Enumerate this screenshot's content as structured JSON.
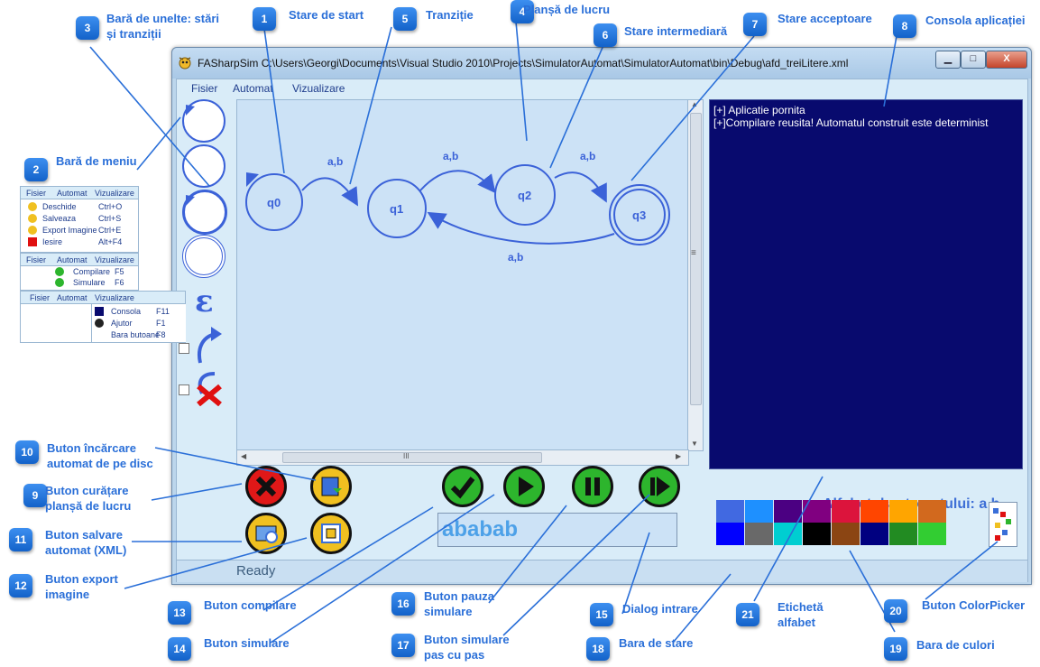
{
  "window": {
    "title": "FASharpSim C:\\Users\\Georgi\\Documents\\Visual Studio 2010\\Projects\\SimulatorAutomat\\SimulatorAutomat\\bin\\Debug\\afd_treiLitere.xml",
    "minimize": "▁",
    "maximize": "□",
    "close": "X"
  },
  "menu": {
    "file": "Fisier",
    "automaton": "Automat",
    "view": "Vizualizare"
  },
  "automaton": {
    "states": [
      "q0",
      "q1",
      "q2",
      "q3"
    ],
    "transitions": [
      "a,b",
      "a,b",
      "a,b",
      "a,b"
    ]
  },
  "console": {
    "lines": [
      "[+] Aplicatie pornita",
      "[+]Compilare reusita! Automatul construit este determinist"
    ]
  },
  "input": {
    "value": "ababab"
  },
  "alphabet_label": "Alfabetul automatului: a b",
  "status": "Ready",
  "scroll_glyphs": {
    "up": "▲",
    "down": "▼",
    "left": "◀",
    "right": "▶",
    "grip": "≡",
    "hgrip": "III"
  },
  "colors": {
    "top_row": [
      "#4169e1",
      "#1e90ff",
      "#4b0082",
      "#800080",
      "#dc143c",
      "#ff4500",
      "#ffa500",
      "#d2691e"
    ],
    "bottom_row": [
      "#0000ff",
      "#696969",
      "#00ced1",
      "#000000",
      "#8b4513",
      "#000080",
      "#228b22",
      "#32cd32"
    ]
  },
  "inset_menus": {
    "file": {
      "tabs": [
        "Fisier",
        "Automat",
        "Vizualizare"
      ],
      "items": [
        {
          "label": "Deschide",
          "shortcut": "Ctrl+O"
        },
        {
          "label": "Salveaza",
          "shortcut": "Ctrl+S"
        },
        {
          "label": "Export Imagine",
          "shortcut": "Ctrl+E"
        },
        {
          "label": "Iesire",
          "shortcut": "Alt+F4"
        }
      ]
    },
    "automaton": {
      "tabs": [
        "Fisier",
        "Automat",
        "Vizualizare"
      ],
      "items": [
        {
          "label": "Compilare",
          "shortcut": "F5"
        },
        {
          "label": "Simulare",
          "shortcut": "F6"
        }
      ]
    },
    "view": {
      "tabs": [
        "Fisier",
        "Automat",
        "Vizualizare"
      ],
      "items": [
        {
          "label": "Consola",
          "shortcut": "F11"
        },
        {
          "label": "Ajutor",
          "shortcut": "F1"
        },
        {
          "label": "Bara butoane",
          "shortcut": "F8"
        }
      ]
    }
  },
  "annotations": [
    {
      "n": "1",
      "text": "Stare de start"
    },
    {
      "n": "2",
      "text": "Bară de meniu"
    },
    {
      "n": "3",
      "text": "Bară de unelte: stări\nși tranziții"
    },
    {
      "n": "4",
      "text": "Planșă de lucru"
    },
    {
      "n": "5",
      "text": "Tranziție"
    },
    {
      "n": "6",
      "text": "Stare intermediară"
    },
    {
      "n": "7",
      "text": "Stare acceptoare"
    },
    {
      "n": "8",
      "text": "Consola aplicației"
    },
    {
      "n": "9",
      "text": "Buton curățare\nplanșă de lucru"
    },
    {
      "n": "10",
      "text": "Buton încărcare\nautomat de pe disc"
    },
    {
      "n": "11",
      "text": "Buton salvare\nautomat (XML)"
    },
    {
      "n": "12",
      "text": "Buton export\nimagine"
    },
    {
      "n": "13",
      "text": "Buton compilare"
    },
    {
      "n": "14",
      "text": "Buton simulare"
    },
    {
      "n": "15",
      "text": "Dialog intrare"
    },
    {
      "n": "16",
      "text": "Buton pauza\nsimulare"
    },
    {
      "n": "17",
      "text": "Buton simulare\npas cu pas"
    },
    {
      "n": "18",
      "text": "Bara de stare"
    },
    {
      "n": "19",
      "text": "Bara de culori"
    },
    {
      "n": "20",
      "text": "Buton ColorPicker"
    },
    {
      "n": "21",
      "text": "Etichetă\nalfabet"
    }
  ]
}
